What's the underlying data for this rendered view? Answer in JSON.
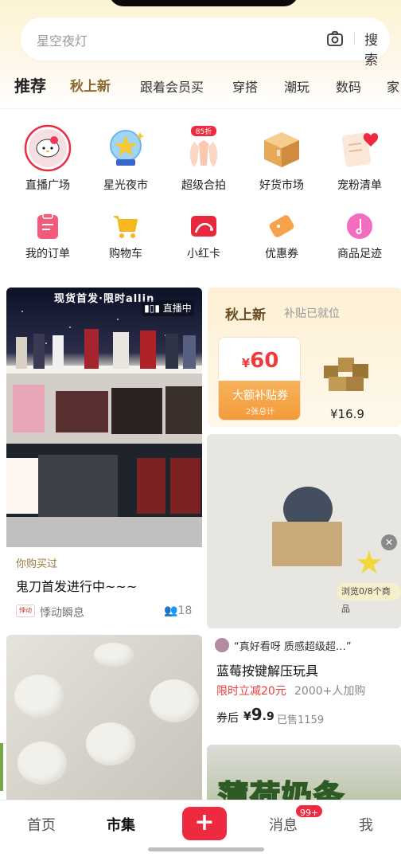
{
  "search": {
    "placeholder": "星空夜灯",
    "button": "搜索"
  },
  "tabs": [
    {
      "label": "推荐"
    },
    {
      "label": "秋上新"
    },
    {
      "label": "跟着会员买"
    },
    {
      "label": "穿搭"
    },
    {
      "label": "潮玩"
    },
    {
      "label": "数码"
    },
    {
      "label": "家"
    }
  ],
  "shortcuts_row1": [
    {
      "label": "直播广场",
      "icon": "live-square-icon"
    },
    {
      "label": "星光夜市",
      "icon": "crystal-ball-icon"
    },
    {
      "label": "超级合拍",
      "icon": "clap-hands-icon",
      "badge": "85折"
    },
    {
      "label": "好货市场",
      "icon": "box-icon"
    },
    {
      "label": "宠粉清单",
      "icon": "heart-list-icon"
    }
  ],
  "shortcuts_row2": [
    {
      "label": "我的订单",
      "icon": "order-icon"
    },
    {
      "label": "购物车",
      "icon": "cart-icon"
    },
    {
      "label": "小红卡",
      "icon": "red-card-icon"
    },
    {
      "label": "优惠券",
      "icon": "coupon-icon"
    },
    {
      "label": "商品足迹",
      "icon": "footprint-icon"
    }
  ],
  "feed": {
    "live_card": {
      "banner": "现货首发·限时allin",
      "live_label": "直播中",
      "tag": "你购买过",
      "title": "鬼刀首发进行中~~~",
      "shop": "悸动瞬息",
      "shop_logo": "悸动",
      "viewers": "18"
    },
    "autumn_card": {
      "title": "秋上新",
      "subtitle": "补贴已就位",
      "coupon_currency": "¥",
      "coupon_amount": "60",
      "coupon_label": "大额补贴券",
      "coupon_total": "2张总计",
      "product_price": "¥16.9"
    },
    "product_image_card": {
      "browse_label": "浏览0/8个商品"
    },
    "product_card": {
      "quote": "“真好看呀 质感超级超…”",
      "title": "蓝莓按键解压玩具",
      "promo": "限时立减20元",
      "buyers": "2000+人加购",
      "after_label": "券后",
      "after_currency": "¥",
      "after_int": "9",
      "after_dec": ".9",
      "sold": "已售1159"
    },
    "mint_card": {
      "text": "薄荷奶条"
    }
  },
  "bottom_nav": {
    "home": "首页",
    "market": "市集",
    "messages": "消息",
    "messages_badge": "99+",
    "me": "我"
  },
  "colors": {
    "accent": "#ee2a41",
    "gold": "#8a6a30",
    "price_red": "#ee3b3b"
  }
}
